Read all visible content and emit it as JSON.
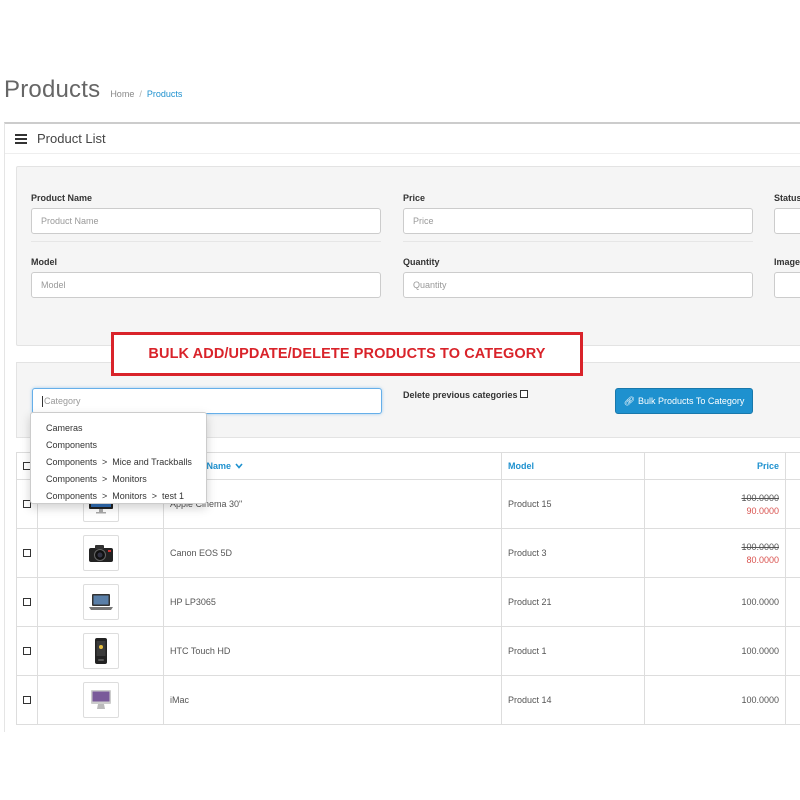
{
  "page": {
    "title": "Products",
    "breadcrumb": {
      "home": "Home",
      "separator": "/",
      "current": "Products"
    }
  },
  "panel": {
    "title": "Product List",
    "icon": "list-icon"
  },
  "filter": {
    "product_name": {
      "label": "Product Name",
      "placeholder": "Product Name"
    },
    "price": {
      "label": "Price",
      "placeholder": "Price"
    },
    "status": {
      "label": "Status"
    },
    "model": {
      "label": "Model",
      "placeholder": "Model"
    },
    "quantity": {
      "label": "Quantity",
      "placeholder": "Quantity"
    },
    "image": {
      "label": "Image"
    }
  },
  "bulk": {
    "banner": "BULK ADD/UPDATE/DELETE PRODUCTS TO CATEGORY",
    "category_placeholder": "Category",
    "delete_label": "Delete previous categories",
    "button_label": "Bulk Products To Category",
    "button_icon": "link-icon"
  },
  "autocomplete": [
    "Cameras",
    "Components",
    "Components  >  Mice and Trackballs",
    "Components  >  Monitors",
    "Components  >  Monitors  >  test 1"
  ],
  "table": {
    "headers": {
      "name": "Product Name",
      "model": "Model",
      "price": "Price",
      "sort_icon": "chevron-down-icon"
    },
    "rows": [
      {
        "name": "Apple Cinema 30\"",
        "model": "Product 15",
        "price": "100.0000",
        "special": "90.0000",
        "image": "monitor"
      },
      {
        "name": "Canon EOS 5D",
        "model": "Product 3",
        "price": "100.0000",
        "special": "80.0000",
        "image": "camera"
      },
      {
        "name": "HP LP3065",
        "model": "Product 21",
        "price": "100.0000",
        "special": "",
        "image": "laptop"
      },
      {
        "name": "HTC Touch HD",
        "model": "Product 1",
        "price": "100.0000",
        "special": "",
        "image": "phone"
      },
      {
        "name": "iMac",
        "model": "Product 14",
        "price": "100.0000",
        "special": "",
        "image": "imac"
      }
    ]
  },
  "colors": {
    "accent": "#1e91cf",
    "banner_red": "#d9232a",
    "special_price": "#d9534f"
  }
}
